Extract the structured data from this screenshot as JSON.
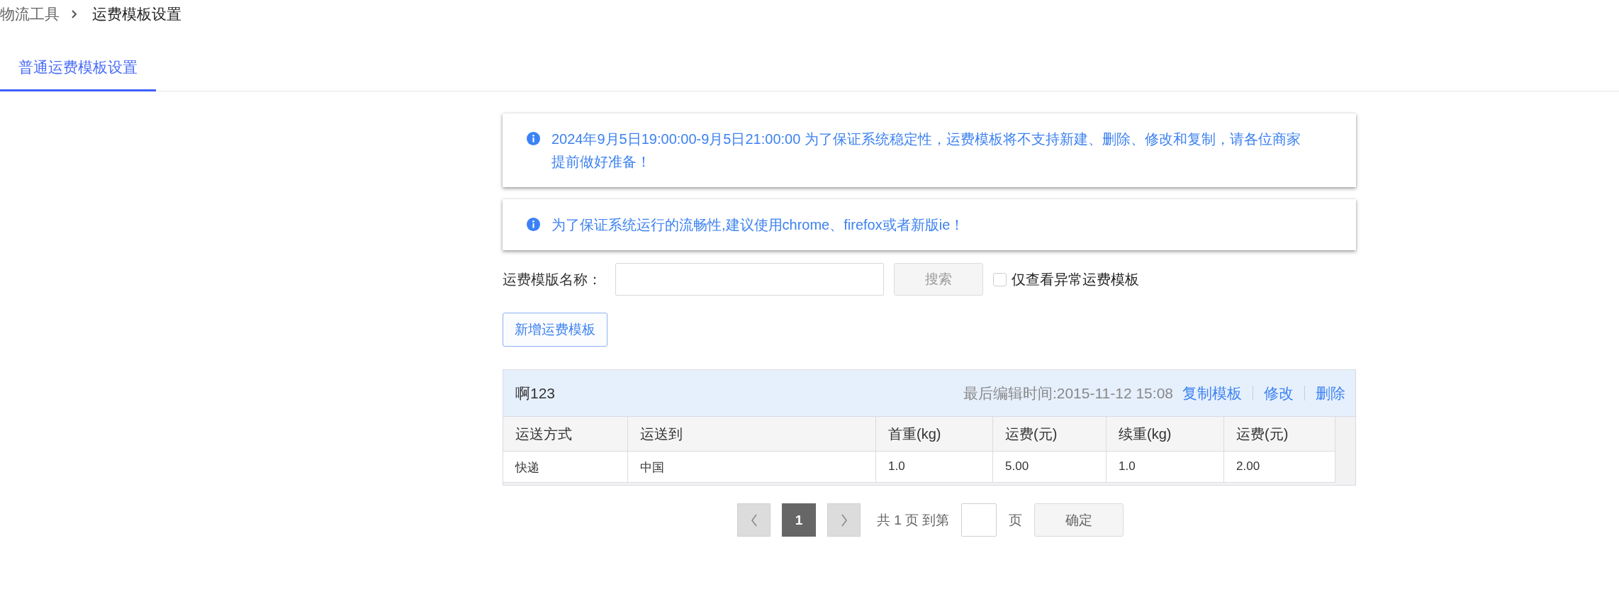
{
  "breadcrumb": [
    {
      "label": "物流工具"
    },
    {
      "label": "运费模板设置"
    }
  ],
  "tabs": [
    {
      "label": "普通运费模板设置",
      "selected": true
    }
  ],
  "notices": [
    {
      "text": "2024年9月5日19:00:00-9月5日21:00:00 为了保证系统稳定性，运费模板将不支持新建、删除、修改和复制，请各位商家提前做好准备！"
    },
    {
      "text": "为了保证系统运行的流畅性,建议使用chrome、firefox或者新版ie！"
    }
  ],
  "search": {
    "label": "运费模版名称：",
    "button": "搜索",
    "checkbox": {
      "label": "仅查看异常运费模板",
      "checked": false
    }
  },
  "add_button": "新增运费模板",
  "templates": [
    {
      "name": "啊123",
      "last_edited": "最后编辑时间:2015-11-12 15:08",
      "actions": [
        "复制模板",
        "修改",
        "删除"
      ],
      "columns": [
        "运送方式",
        "运送到",
        "首重(kg)",
        "运费(元)",
        "续重(kg)",
        "运费(元)"
      ],
      "rows": [
        [
          "快递",
          "中国",
          "1.0",
          "5.00",
          "1.0",
          "2.00"
        ]
      ]
    }
  ],
  "pagination": {
    "prev": {
      "disabled": true
    },
    "pages": [
      {
        "label": "1",
        "selected": true
      }
    ],
    "next": {
      "disabled": true
    },
    "total_text": "共 1 页 到第",
    "page_unit": "页",
    "confirm": "确定"
  }
}
